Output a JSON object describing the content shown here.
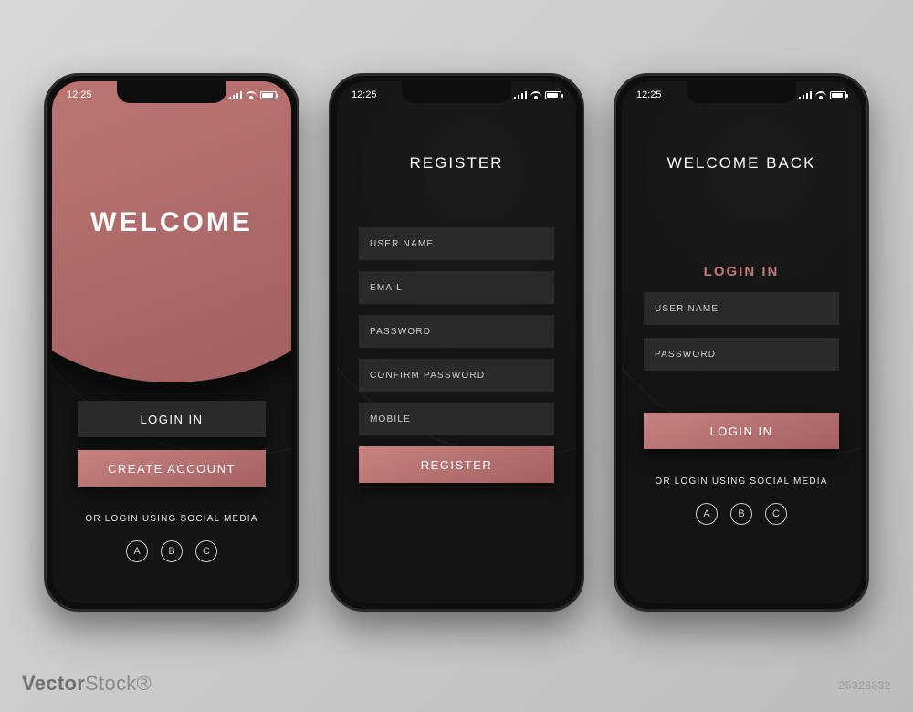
{
  "status": {
    "time": "12:25"
  },
  "screen1": {
    "hero": "WELCOME",
    "login_btn": "LOGIN IN",
    "create_btn": "CREATE ACCOUNT",
    "social_text": "OR LOGIN USING SOCIAL MEDIA",
    "social": [
      "A",
      "B",
      "C"
    ]
  },
  "screen2": {
    "title": "REGISTER",
    "fields": {
      "username": "USER NAME",
      "email": "EMAIL",
      "password": "PASSWORD",
      "confirm": "CONFIRM PASSWORD",
      "mobile": "MOBILE"
    },
    "submit": "REGISTER"
  },
  "screen3": {
    "title": "WELCOME BACK",
    "subtitle": "LOGIN IN",
    "fields": {
      "username": "USER NAME",
      "password": "PASSWORD"
    },
    "submit": "LOGIN IN",
    "social_text": "OR LOGIN USING SOCIAL MEDIA",
    "social": [
      "A",
      "B",
      "C"
    ]
  },
  "watermark": {
    "brand_a": "Vector",
    "brand_b": "Stock",
    "id": "25328832"
  },
  "colors": {
    "accent": "#c07a78",
    "bg_dark": "#141414",
    "field": "#2a2a2a"
  }
}
